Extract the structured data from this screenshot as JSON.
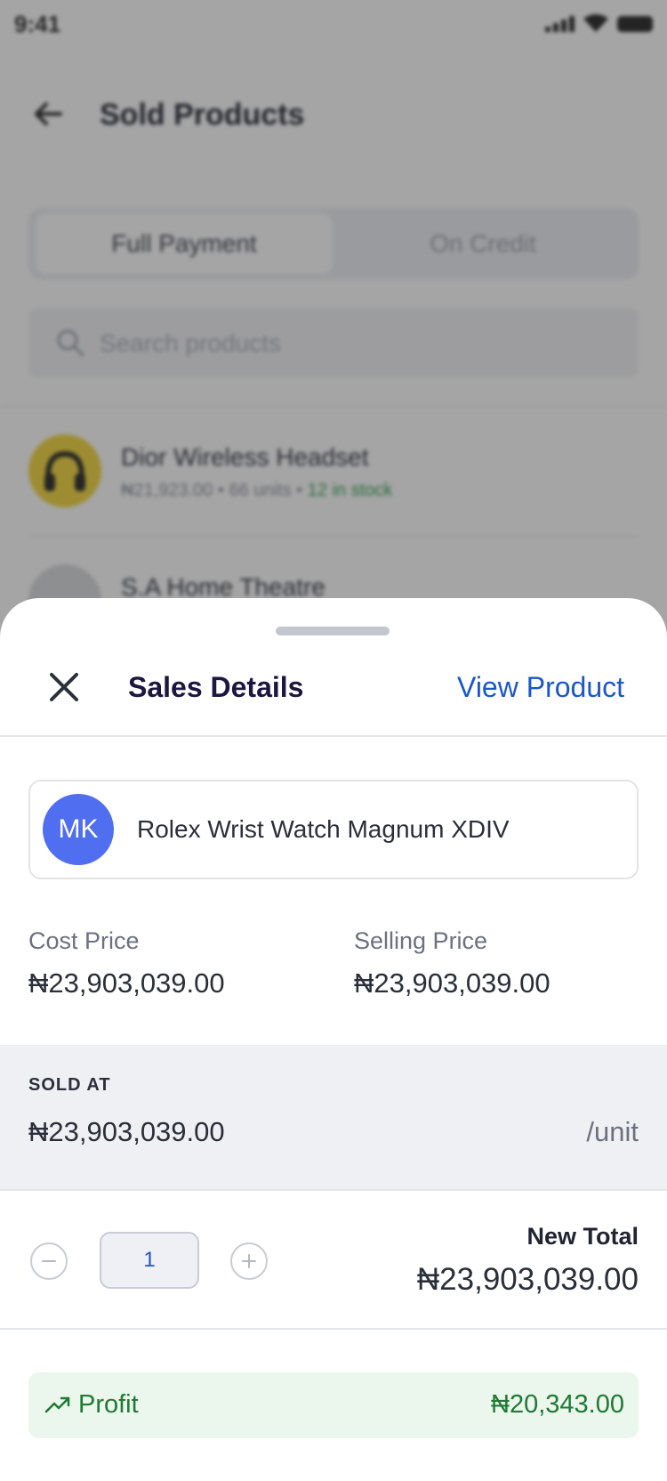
{
  "status_bar": {
    "time": "9:41"
  },
  "background": {
    "header_title": "Sold Products",
    "tabs": [
      {
        "label": "Full Payment",
        "active": true
      },
      {
        "label": "On Credit",
        "active": false
      }
    ],
    "search_placeholder": "Search products",
    "products": [
      {
        "name": "Dior Wireless Headset",
        "meta": "₦21,923.00 • 66 units • ",
        "stock": "12 in stock",
        "avatar_icon": "headphones-icon"
      },
      {
        "name": "S.A Home Theatre",
        "meta": "",
        "stock": "",
        "avatar_icon": "speaker-icon"
      }
    ]
  },
  "sheet": {
    "title": "Sales Details",
    "view_product_label": "View Product",
    "product": {
      "initials": "MK",
      "name": "Rolex Wrist Watch Magnum XDIV"
    },
    "cost_price": {
      "label": "Cost Price",
      "value": "₦23,903,039.00"
    },
    "selling_price": {
      "label": "Selling Price",
      "value": "₦23,903,039.00"
    },
    "sold_at": {
      "label": "SOLD AT",
      "value": "₦23,903,039.00",
      "unit": "/unit"
    },
    "quantity": "1",
    "new_total": {
      "label": "New Total",
      "value": "₦23,903,039.00"
    },
    "profit": {
      "label": "Profit",
      "value": "₦20,343.00"
    }
  },
  "colors": {
    "accent_blue": "#1a57c9",
    "avatar_blue": "#4f6ef0",
    "profit_green": "#1f7a34",
    "profit_bg": "#ebf6ec"
  }
}
